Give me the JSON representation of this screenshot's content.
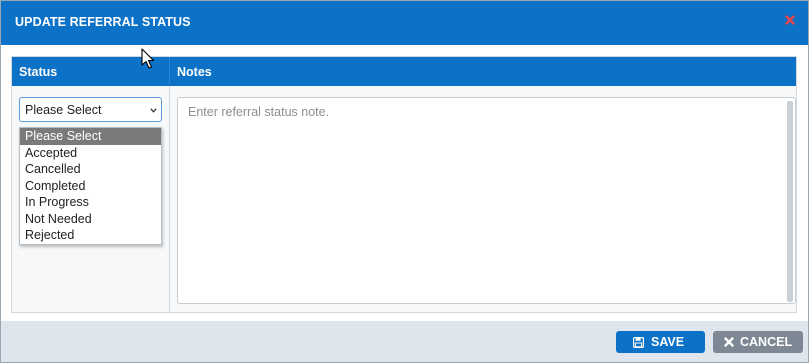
{
  "dialog": {
    "title": "UPDATE REFERRAL STATUS",
    "close_icon": "close-icon",
    "accent_color": "#0c72c7"
  },
  "table": {
    "headers": {
      "status": "Status",
      "notes": "Notes"
    }
  },
  "status_select": {
    "value": "Please Select",
    "options": [
      "Please Select",
      "Accepted",
      "Cancelled",
      "Completed",
      "In Progress",
      "Not Needed",
      "Rejected"
    ],
    "highlighted": "Please Select"
  },
  "notes": {
    "placeholder": "Enter referral status note.",
    "value": ""
  },
  "footer": {
    "save_label": "SAVE",
    "save_icon": "floppy-disk-icon",
    "cancel_label": "CANCEL",
    "cancel_icon": "x-icon"
  }
}
